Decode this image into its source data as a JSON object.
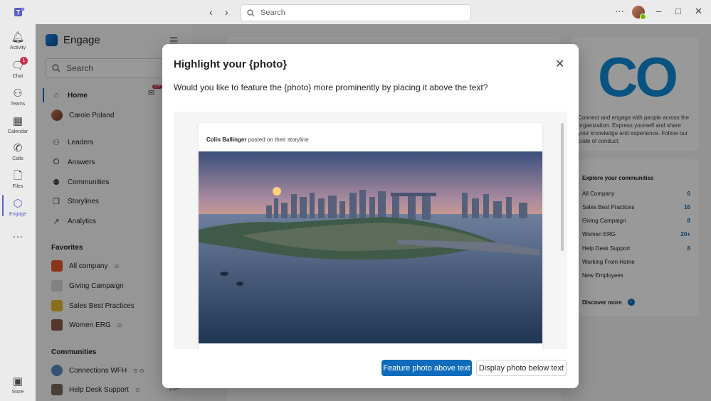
{
  "titlebar": {
    "search_placeholder": "Search",
    "back_icon": "chevron-left-icon",
    "forward_icon": "chevron-right-icon",
    "more_label": "···",
    "minimize_label": "–",
    "maximize_label": "□",
    "close_label": "✕"
  },
  "rail": {
    "items": [
      {
        "label": "Activity",
        "icon": "bell-icon"
      },
      {
        "label": "Chat",
        "icon": "chat-icon",
        "badge": "1"
      },
      {
        "label": "Teams",
        "icon": "teams-icon"
      },
      {
        "label": "Calendar",
        "icon": "calendar-icon"
      },
      {
        "label": "Calls",
        "icon": "phone-icon"
      },
      {
        "label": "Files",
        "icon": "file-icon"
      },
      {
        "label": "Engage",
        "icon": "engage-icon",
        "active": true
      },
      {
        "label": "···",
        "icon": "more-icon"
      },
      {
        "label": "Store",
        "icon": "store-icon"
      }
    ]
  },
  "sidebar": {
    "app_title": "Engage",
    "search_placeholder": "Search",
    "home_label": "Home",
    "home_badge": "20+",
    "user_name": "Carole Poland",
    "nav": [
      "Leaders",
      "Answers",
      "Communities",
      "Storylines",
      "Analytics"
    ],
    "favorites_title": "Favorites",
    "favorites": [
      "All company",
      "Giving Campaign",
      "Sales Best Practices",
      "Women ERG"
    ],
    "communities_title": "Communities",
    "communities": [
      "Connections WFH",
      "Help Desk Support"
    ],
    "communities_badge": "20+"
  },
  "right_panel": {
    "logo_text": "CO",
    "description": "Connect and engage with people across the organization. Express yourself and share your knowledge and experience. Follow our code of conduct.",
    "explore_title": "Explore your communities",
    "communities": [
      {
        "name": "All Company",
        "count": "6"
      },
      {
        "name": "Sales Best Practices",
        "count": "16"
      },
      {
        "name": "Giving Campaign",
        "count": "8"
      },
      {
        "name": "Women ERG",
        "count": "20+"
      },
      {
        "name": "Help Desk Support",
        "count": "8"
      },
      {
        "name": "Working From Home",
        "count": ""
      },
      {
        "name": "New Employees",
        "count": ""
      }
    ],
    "discover_label": "Discover more"
  },
  "modal": {
    "title": "Highlight your {photo}",
    "question": "Would you like to feature the {photo} more prominently by placing it above the text?",
    "post_author": "Colin Ballinger",
    "post_action": "posted on their storyline",
    "primary_button": "Feature photo above text",
    "secondary_button": "Display photo below text"
  }
}
